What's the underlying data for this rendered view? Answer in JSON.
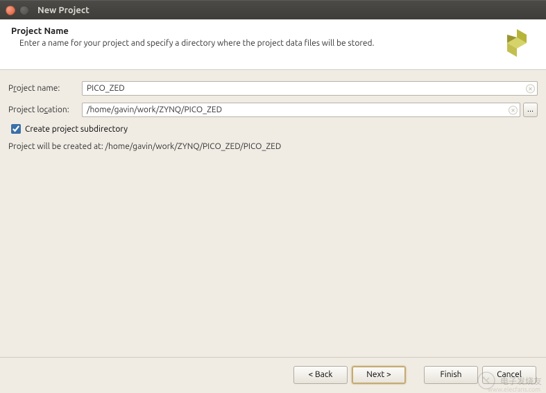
{
  "window": {
    "title": "New Project"
  },
  "header": {
    "title": "Project Name",
    "description": "Enter a name for your project and specify a directory where the project data files will be stored."
  },
  "form": {
    "name_label_pre": "P",
    "name_label_u": "r",
    "name_label_post": "oject name:",
    "name_value": "PICO_ZED",
    "location_label_pre": "Project lo",
    "location_label_u": "c",
    "location_label_post": "ation:",
    "location_value": "/home/gavin/work/ZYNQ/PICO_ZED",
    "browse_label": "...",
    "subdir_checked": true,
    "subdir_label": "Create project subdirectory",
    "info_text": "Project will be created at: /home/gavin/work/ZYNQ/PICO_ZED/PICO_ZED"
  },
  "footer": {
    "back": "< Back",
    "next": "Next >",
    "finish": "Finish",
    "cancel": "Cancel"
  },
  "watermark": {
    "text": "电子发烧友",
    "sub": "www.elecfans.com"
  }
}
